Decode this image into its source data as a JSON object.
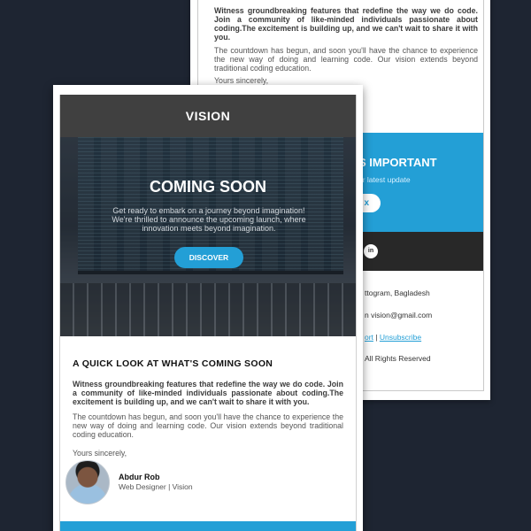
{
  "back_card": {
    "bold_text": "Witness groundbreaking features that redefine the way we do code. Join a community of like-minded individuals passionate about coding.The excitement is building up, and we can't wait to share it with you.",
    "paragraph": "The countdown has begun, and soon you'll have the chance to experience the new way of doing and learning code. Our vision extends beyond traditional coding education.",
    "sign_off": "Yours sincerely,",
    "banner_title": "S IMPORTANT",
    "banner_sub": "ur latest update",
    "banner_button": "x",
    "social_icon": "in",
    "address": "ttogram, Bagladesh",
    "email": "n vision@gmail.com",
    "link_left": "ort",
    "link_separator": " | ",
    "link_unsubscribe": "Unsubscribe",
    "rights": "All Rights Reserved"
  },
  "front_card": {
    "brand": "VISION",
    "hero_title": "COMING SOON",
    "hero_sub": "Get ready to embark on a journey beyond imagination! We're thrilled to announce the upcoming launch, where innovation meets beyond imagination.",
    "discover_label": "DISCOVER",
    "section_title": "A QUICK LOOK AT WHAT'S COMING SOON",
    "bold_text": "Witness groundbreaking features that redefine the way we do code. Join a community of like-minded individuals passionate about coding.The excitement is building up, and we can't wait to share it with you.",
    "paragraph": "The countdown has begun, and soon you'll have the chance to experience the new way of doing and learning code. Our vision extends beyond traditional coding education.",
    "sign_off": "Yours sincerely,",
    "signer_name": "Abdur Rob",
    "signer_role": "Web Designer | Vision"
  },
  "colors": {
    "background": "#1e2532",
    "accent_blue": "#239fd6",
    "header_dark": "#404040",
    "footer_dark": "#282828"
  },
  "icons": {
    "linkedin": "linkedin-icon",
    "avatar": "person-avatar"
  }
}
